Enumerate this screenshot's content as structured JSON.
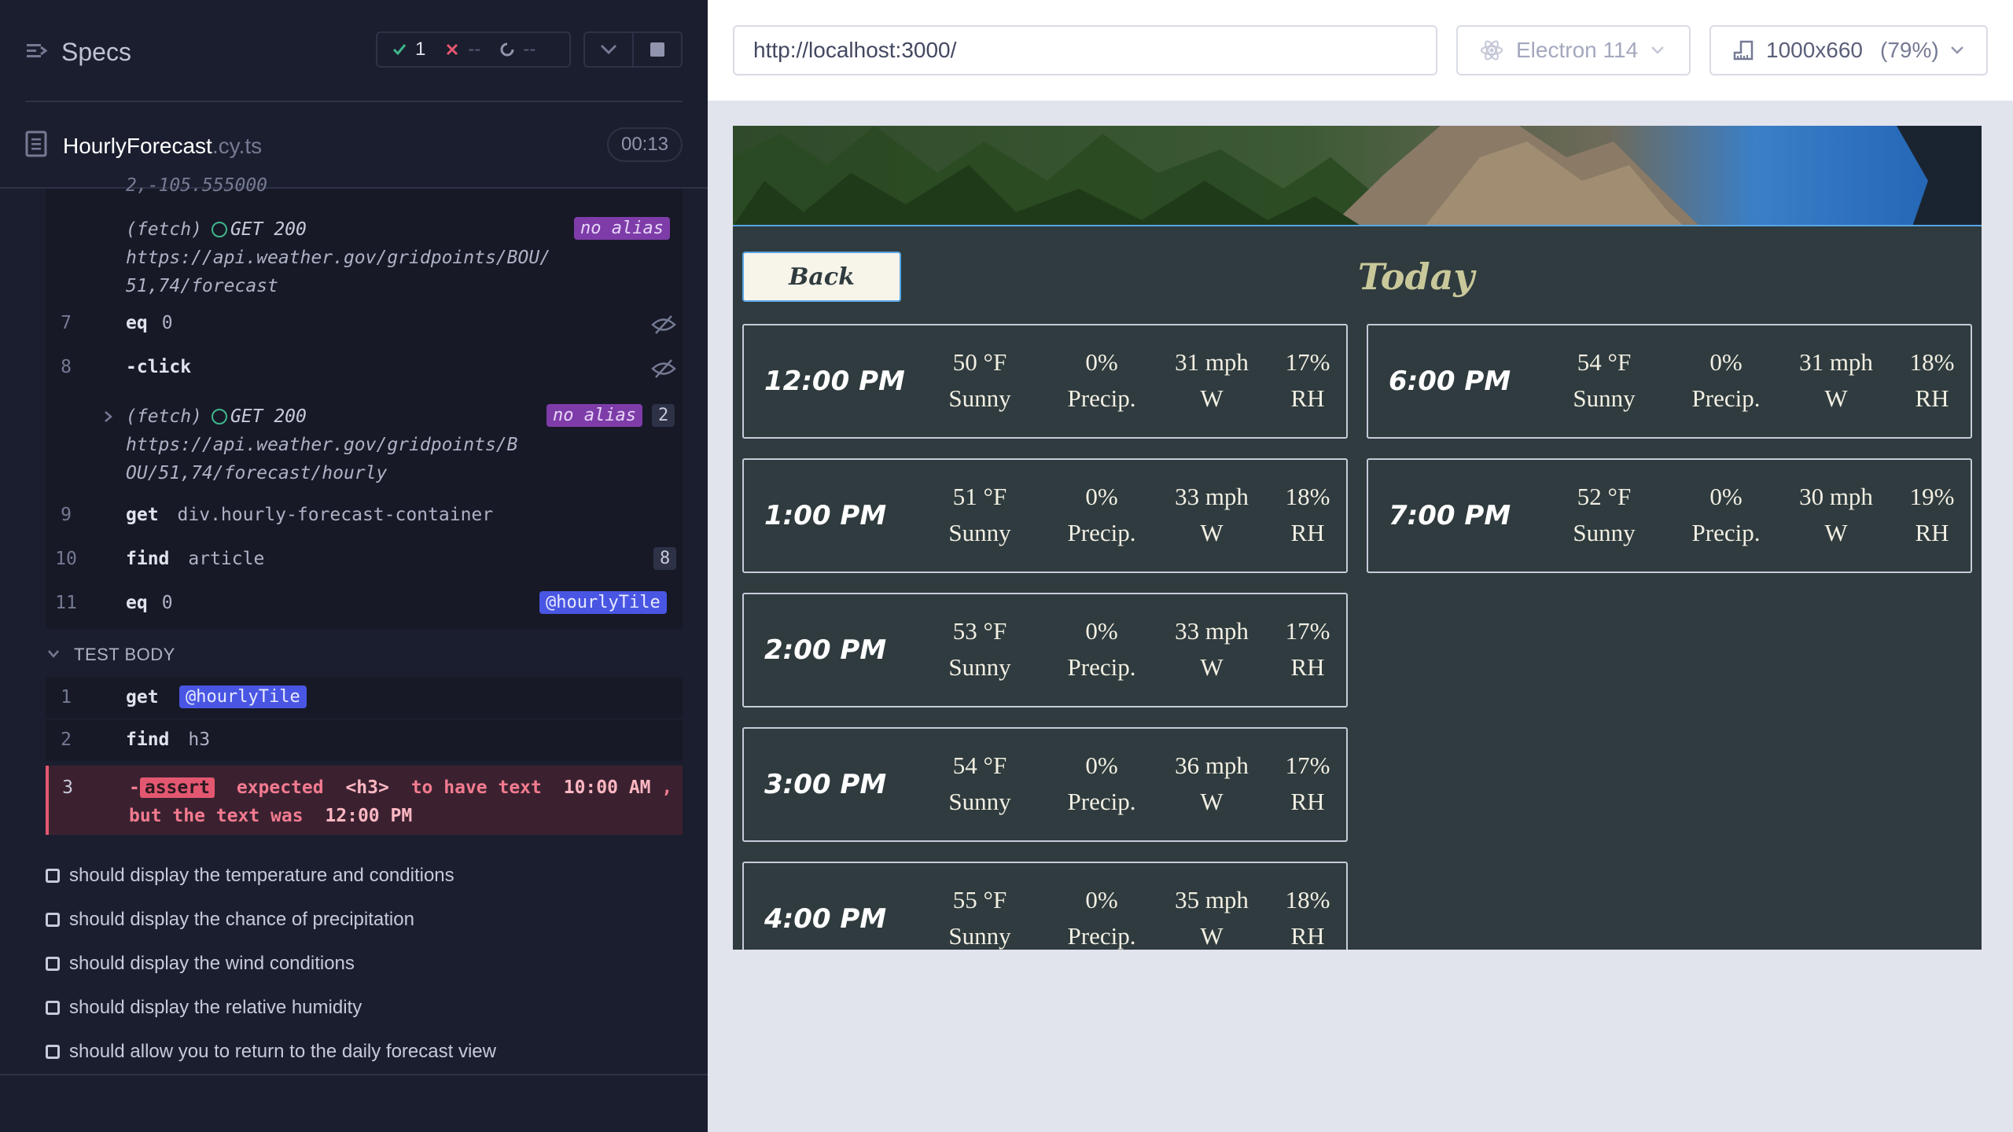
{
  "reporter": {
    "title": "Specs",
    "stats": {
      "passed": "1",
      "failed": "--",
      "pending": "--"
    },
    "spec": {
      "name": "HourlyForecast",
      "ext": ".cy.ts",
      "duration": "00:13"
    },
    "log": {
      "clipped_text": "2,-105.555000",
      "fetch1": {
        "type": "(fetch)",
        "status": "GET 200",
        "alias": "no alias",
        "url_line1": "https://api.weather.gov/gridpoints/BOU/",
        "url_line2": "51,74/forecast"
      },
      "cmd7": {
        "num": "7",
        "name": "eq",
        "arg": "0"
      },
      "cmd8": {
        "num": "8",
        "name": "-click"
      },
      "fetch2": {
        "type": "(fetch)",
        "status": "GET 200",
        "alias": "no alias",
        "count": "2",
        "url_line1": "https://api.weather.gov/gridpoints/B",
        "url_line2": "OU/51,74/forecast/hourly"
      },
      "cmd9": {
        "num": "9",
        "name": "get",
        "arg": "div.hourly-forecast-container"
      },
      "cmd10": {
        "num": "10",
        "name": "find",
        "arg": "article",
        "count": "8"
      },
      "cmd11": {
        "num": "11",
        "name": "eq",
        "arg": "0",
        "alias": "@hourlyTile"
      }
    },
    "test_body": {
      "header": "TEST BODY",
      "cmd1": {
        "num": "1",
        "name": "get",
        "alias": "@hourlyTile"
      },
      "cmd2": {
        "num": "2",
        "name": "find",
        "arg": "h3"
      },
      "cmd3": {
        "num": "3",
        "dash": "-",
        "tag": "assert",
        "w1": "expected",
        "el": "<h3>",
        "w2": "to have text",
        "expected": "10:00 AM",
        "comma": ",",
        "w3": "but the text was",
        "actual": "12:00 PM"
      }
    },
    "tests": [
      "should display the temperature and conditions",
      "should display the chance of precipitation",
      "should display the wind conditions",
      "should display the relative humidity",
      "should allow you to return to the daily forecast view"
    ]
  },
  "aut": {
    "url": "http://localhost:3000/",
    "browser": "Electron 114",
    "viewport": "1000x660",
    "scale": "(79%)"
  },
  "app": {
    "back_label": "Back",
    "heading": "Today",
    "tiles": [
      {
        "time": "12:00 PM",
        "temp": "50 °F",
        "cond": "Sunny",
        "precip": "0%",
        "precip_label": "Precip.",
        "wind": "31 mph",
        "dir": "W",
        "rh": "17%",
        "rh_label": "RH"
      },
      {
        "time": "6:00 PM",
        "temp": "54 °F",
        "cond": "Sunny",
        "precip": "0%",
        "precip_label": "Precip.",
        "wind": "31 mph",
        "dir": "W",
        "rh": "18%",
        "rh_label": "RH"
      },
      {
        "time": "1:00 PM",
        "temp": "51 °F",
        "cond": "Sunny",
        "precip": "0%",
        "precip_label": "Precip.",
        "wind": "33 mph",
        "dir": "W",
        "rh": "18%",
        "rh_label": "RH"
      },
      {
        "time": "7:00 PM",
        "temp": "52 °F",
        "cond": "Sunny",
        "precip": "0%",
        "precip_label": "Precip.",
        "wind": "30 mph",
        "dir": "W",
        "rh": "19%",
        "rh_label": "RH"
      },
      {
        "time": "2:00 PM",
        "temp": "53 °F",
        "cond": "Sunny",
        "precip": "0%",
        "precip_label": "Precip.",
        "wind": "33 mph",
        "dir": "W",
        "rh": "17%",
        "rh_label": "RH"
      },
      {
        "time": "3:00 PM",
        "temp": "54 °F",
        "cond": "Sunny",
        "precip": "0%",
        "precip_label": "Precip.",
        "wind": "36 mph",
        "dir": "W",
        "rh": "17%",
        "rh_label": "RH"
      },
      {
        "time": "4:00 PM",
        "temp": "55 °F",
        "cond": "Sunny",
        "precip": "0%",
        "precip_label": "Precip.",
        "wind": "35 mph",
        "dir": "W",
        "rh": "18%",
        "rh_label": "RH"
      }
    ]
  },
  "colors": {
    "reporter_bg": "#1b1e2e",
    "pass": "#3fb68b",
    "fail": "#e45770",
    "alias_purple": "#7e3ca9",
    "alias_blue": "#4956e3",
    "app_bg": "#2f3b3e",
    "heading": "#c9c89a"
  }
}
